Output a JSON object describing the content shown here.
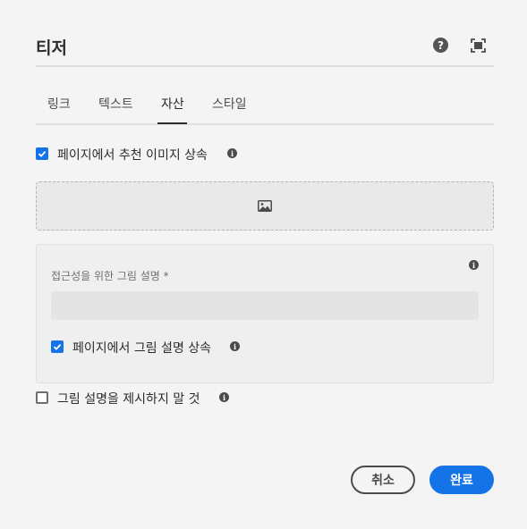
{
  "dialog": {
    "title": "티저",
    "help_glyph": "?",
    "help_icon": "help-icon",
    "fullscreen_icon": "fullscreen-icon"
  },
  "tabs": [
    {
      "label": "링크",
      "active": false
    },
    {
      "label": "텍스트",
      "active": false
    },
    {
      "label": "자산",
      "active": true
    },
    {
      "label": "스타일",
      "active": false
    }
  ],
  "asset": {
    "inherit_image_label": "페이지에서 추천 이미지 상속",
    "inherit_image_checked": true,
    "image_placeholder_icon": "image-icon",
    "alt_text_label": "접근성을 위한 그림 설명 *",
    "alt_text_value": "",
    "inherit_alt_label": "페이지에서 그림 설명 상속",
    "inherit_alt_checked": true,
    "no_alt_label": "그림 설명을 제시하지 말 것",
    "no_alt_checked": false
  },
  "footer": {
    "cancel_label": "취소",
    "done_label": "완료"
  },
  "colors": {
    "accent": "#1473e6",
    "background": "#f4f4f4",
    "text": "#2c2c2c"
  }
}
